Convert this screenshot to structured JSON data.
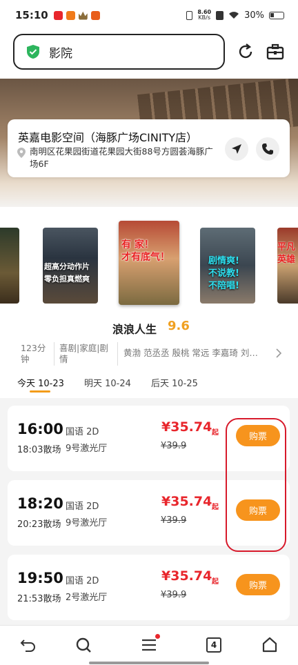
{
  "status_bar": {
    "time": "15:10",
    "net_speed_top": "8.60",
    "net_speed_bottom": "KB/s",
    "battery": "30%"
  },
  "search": {
    "text": "影院"
  },
  "cinema": {
    "name": "英嘉电影空间（海豚广场CINITY店）",
    "address": "南明区花果园街道花果园大街88号方圆荟海豚广场6F"
  },
  "posters": [
    {
      "text": ""
    },
    {
      "text": "超高分动作片\n零负担真燃爽"
    },
    {
      "text": "有 家！\n才有底气！"
    },
    {
      "text": "剧情爽!\n不说教!\n不陪唱!"
    },
    {
      "text": "平凡\n英雄"
    }
  ],
  "movie": {
    "title": "浪浪人生",
    "score": "9.6",
    "duration": "123分钟",
    "genres": "喜剧|家庭|剧情",
    "cast": "黄渤 范丞丞 殷桃 常远 李嘉琦 刘…"
  },
  "date_tabs": [
    {
      "label": "今天 10-23",
      "active": true
    },
    {
      "label": "明天 10-24",
      "active": false
    },
    {
      "label": "后天 10-25",
      "active": false
    }
  ],
  "showtimes": [
    {
      "start": "16:00",
      "end": "18:03散场",
      "lang": "国语 2D",
      "hall": "9号激光厅",
      "price": "¥35.74",
      "price_suffix": "起",
      "original_price": "¥39.9",
      "buy_label": "购票"
    },
    {
      "start": "18:20",
      "end": "20:23散场",
      "lang": "国语 2D",
      "hall": "9号激光厅",
      "price": "¥35.74",
      "price_suffix": "起",
      "original_price": "¥39.9",
      "buy_label": "购票"
    },
    {
      "start": "19:50",
      "end": "21:53散场",
      "lang": "国语 2D",
      "hall": "2号激光厅",
      "price": "¥35.74",
      "price_suffix": "起",
      "original_price": "¥39.9",
      "buy_label": "购票"
    }
  ],
  "nav": {
    "tab_count": "4"
  },
  "colors": {
    "accent": "#f7941d",
    "price": "#e8262c",
    "score": "#f0a020",
    "highlight": "#d7192a"
  }
}
